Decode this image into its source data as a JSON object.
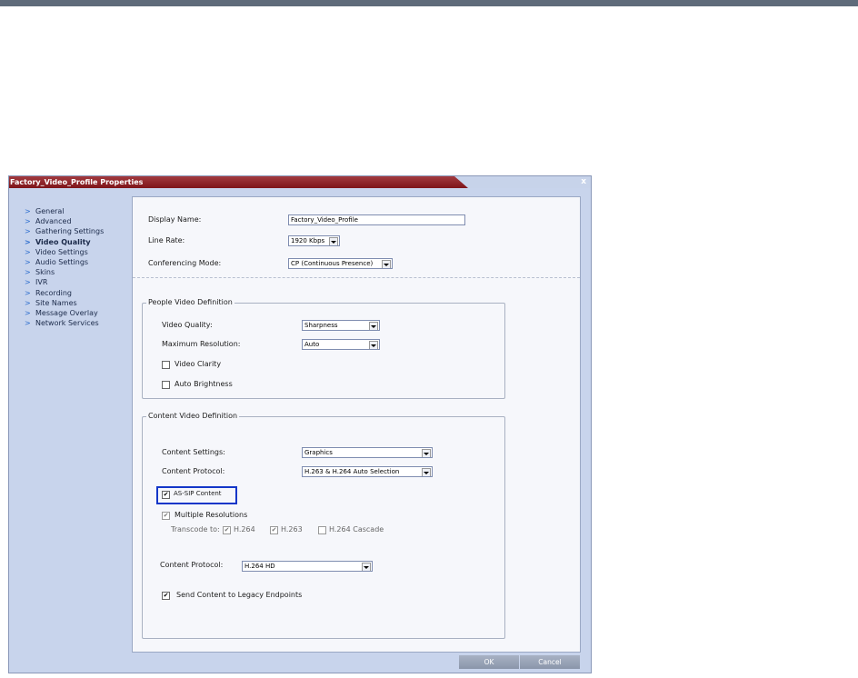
{
  "dialog": {
    "title": "Factory_Video_Profile Properties",
    "close_label": "x"
  },
  "nav": {
    "items": [
      {
        "label": "General",
        "active": false
      },
      {
        "label": "Advanced",
        "active": false
      },
      {
        "label": "Gathering Settings",
        "active": false
      },
      {
        "label": "Video Quality",
        "active": true
      },
      {
        "label": "Video Settings",
        "active": false
      },
      {
        "label": "Audio Settings",
        "active": false
      },
      {
        "label": "Skins",
        "active": false
      },
      {
        "label": "IVR",
        "active": false
      },
      {
        "label": "Recording",
        "active": false
      },
      {
        "label": "Site Names",
        "active": false
      },
      {
        "label": "Message Overlay",
        "active": false
      },
      {
        "label": "Network Services",
        "active": false
      }
    ],
    "arrow_glyph": ">"
  },
  "general": {
    "display_name_label": "Display Name:",
    "display_name_value": "Factory_Video_Profile",
    "line_rate_label": "Line Rate:",
    "line_rate_value": "1920 Kbps",
    "conferencing_mode_label": "Conferencing Mode:",
    "conferencing_mode_value": "CP (Continuous Presence)"
  },
  "people_video": {
    "legend": "People Video Definition",
    "video_quality_label": "Video Quality:",
    "video_quality_value": "Sharpness",
    "max_resolution_label": "Maximum Resolution:",
    "max_resolution_value": "Auto",
    "video_clarity_label": "Video Clarity",
    "video_clarity_checked": false,
    "auto_brightness_label": "Auto Brightness",
    "auto_brightness_checked": false
  },
  "content_video": {
    "legend": "Content Video Definition",
    "content_settings_label": "Content Settings:",
    "content_settings_value": "Graphics",
    "content_protocol_label": "Content Protocol:",
    "content_protocol_value": "H.263 & H.264 Auto Selection",
    "as_sip_label": "AS-SIP Content",
    "as_sip_checked": true,
    "multiple_resolutions_label": "Multiple Resolutions",
    "multiple_resolutions_checked": true,
    "transcode_label": "Transcode to:",
    "transcode_h264_label": "H.264",
    "transcode_h264_checked": true,
    "transcode_h263_label": "H.263",
    "transcode_h263_checked": true,
    "transcode_cascade_label": "H.264 Cascade",
    "transcode_cascade_checked": false,
    "content_protocol2_label": "Content Protocol:",
    "content_protocol2_value": "H.264 HD",
    "send_legacy_label": "Send Content to Legacy Endpoints",
    "send_legacy_checked": true
  },
  "footer": {
    "ok_label": "OK",
    "cancel_label": "Cancel"
  },
  "colors": {
    "title_bar": "#8b1e24",
    "highlight_border": "#1336c8",
    "nav_arrow": "#2f6fcf"
  }
}
